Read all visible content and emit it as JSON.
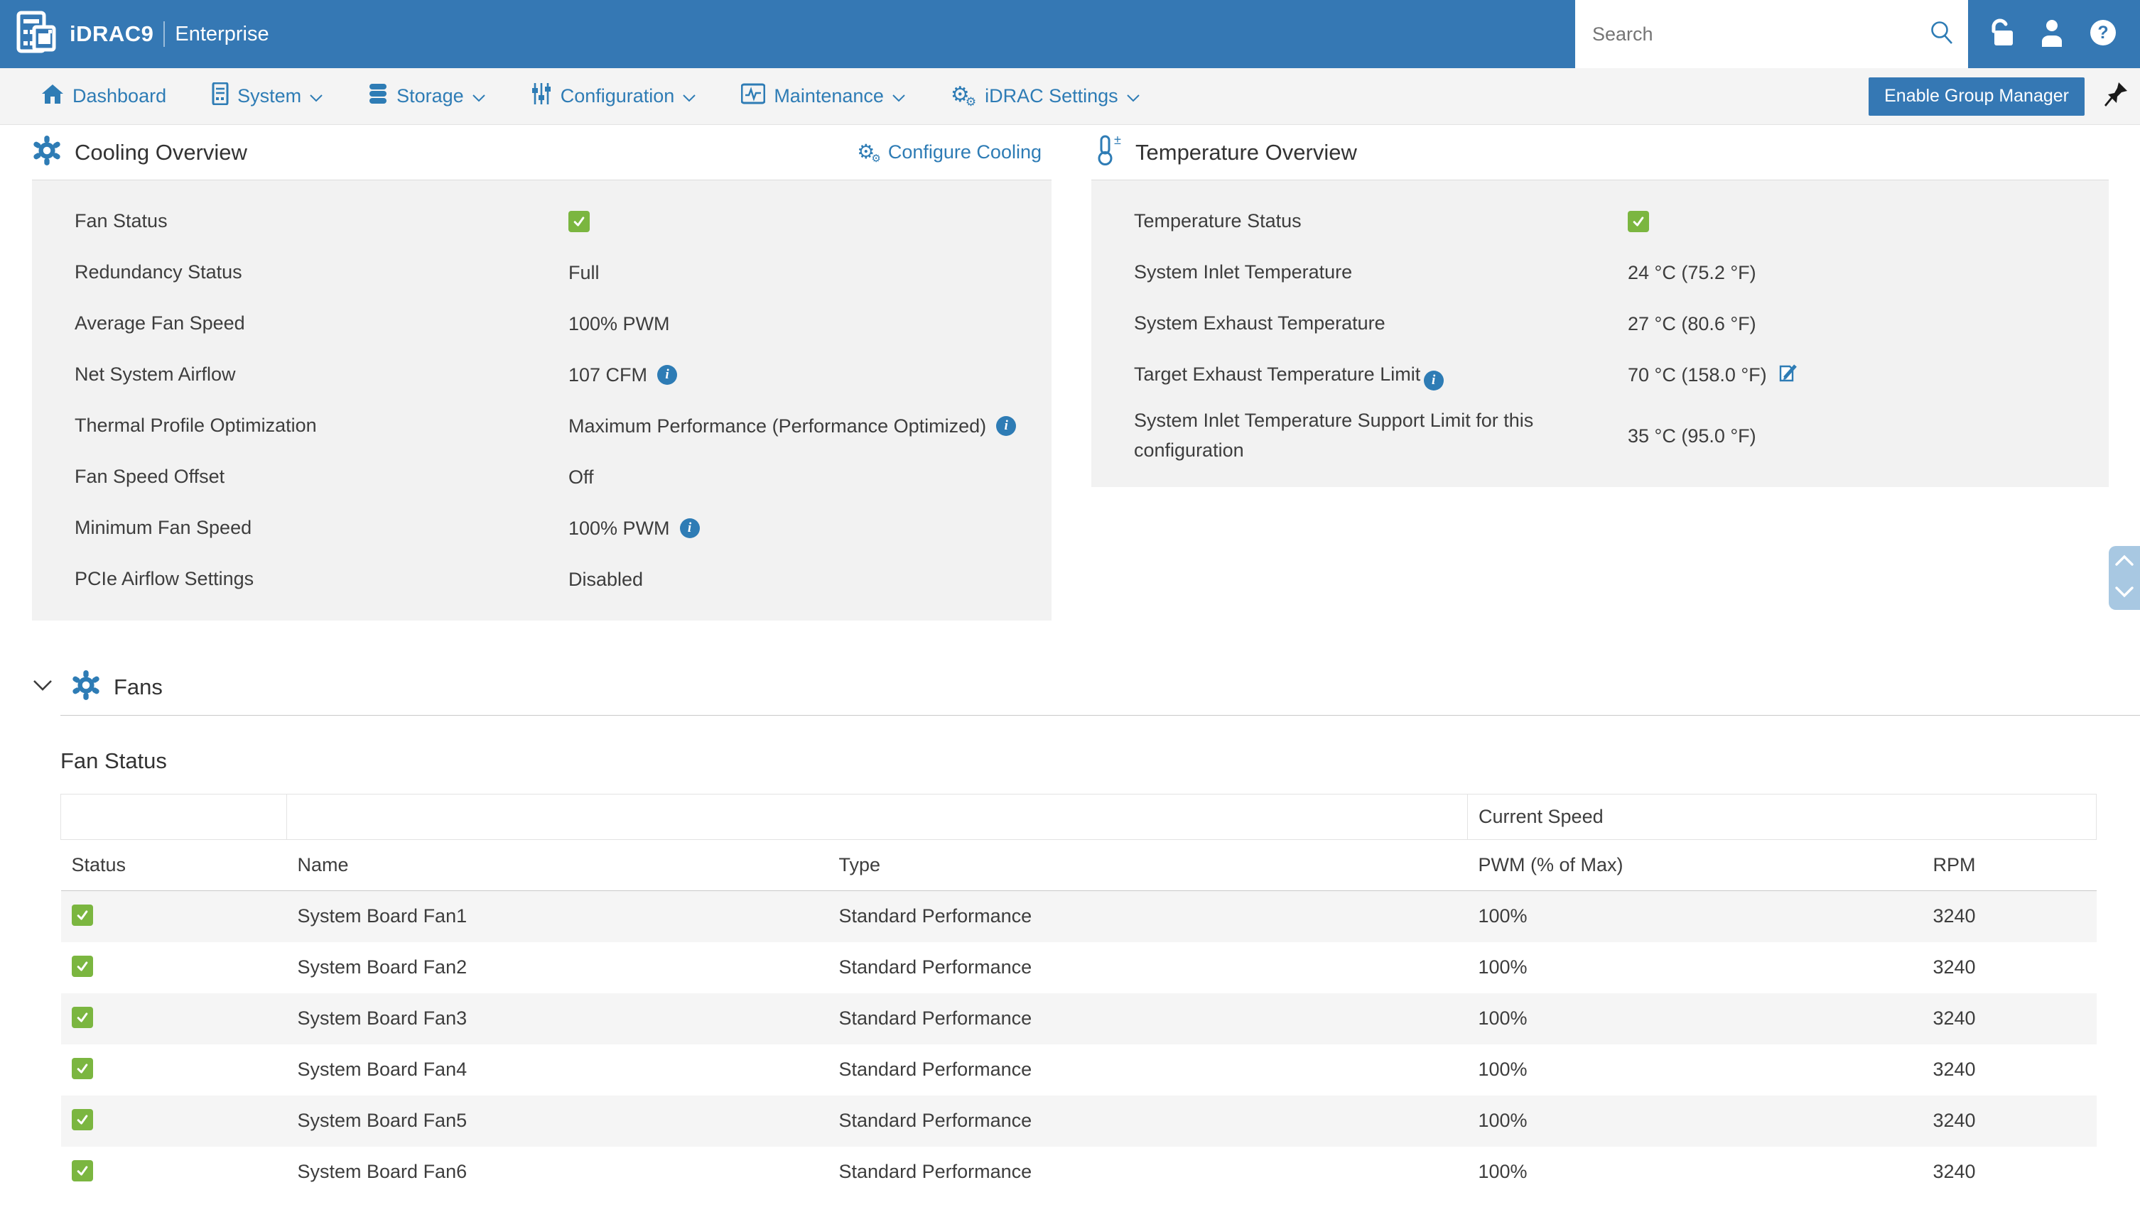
{
  "header": {
    "product": "iDRAC9",
    "edition": "Enterprise",
    "search_placeholder": "Search"
  },
  "nav": {
    "items": [
      {
        "label": "Dashboard"
      },
      {
        "label": "System"
      },
      {
        "label": "Storage"
      },
      {
        "label": "Configuration"
      },
      {
        "label": "Maintenance"
      },
      {
        "label": "iDRAC Settings"
      }
    ],
    "enable_group_manager_label": "Enable Group Manager"
  },
  "cooling_overview": {
    "title": "Cooling Overview",
    "configure_link": "Configure Cooling",
    "rows": [
      {
        "label": "Fan Status",
        "value": "OK"
      },
      {
        "label": "Redundancy Status",
        "value": "Full"
      },
      {
        "label": "Average Fan Speed",
        "value": "100% PWM"
      },
      {
        "label": "Net System Airflow",
        "value": "107 CFM"
      },
      {
        "label": "Thermal Profile Optimization",
        "value": "Maximum Performance (Performance Optimized)"
      },
      {
        "label": "Fan Speed Offset",
        "value": "Off"
      },
      {
        "label": "Minimum Fan Speed",
        "value": "100% PWM"
      },
      {
        "label": "PCIe Airflow Settings",
        "value": "Disabled"
      }
    ]
  },
  "temperature_overview": {
    "title": "Temperature Overview",
    "rows": [
      {
        "label": "Temperature Status",
        "value": "OK"
      },
      {
        "label": "System Inlet Temperature",
        "value": "24 °C (75.2 °F)"
      },
      {
        "label": "System Exhaust Temperature",
        "value": "27 °C (80.6 °F)"
      },
      {
        "label": "Target Exhaust Temperature Limit",
        "value": "70 °C (158.0 °F)"
      },
      {
        "label": "System Inlet Temperature Support Limit for this configuration",
        "value": "35 °C (95.0 °F)"
      }
    ]
  },
  "fans_section": {
    "title": "Fans",
    "table_title": "Fan Status",
    "group_header": "Current Speed",
    "columns": [
      "Status",
      "Name",
      "Type",
      "PWM (% of Max)",
      "RPM"
    ],
    "rows": [
      {
        "status": "OK",
        "name": "System Board Fan1",
        "type": "Standard Performance",
        "pwm": "100%",
        "rpm": "3240"
      },
      {
        "status": "OK",
        "name": "System Board Fan2",
        "type": "Standard Performance",
        "pwm": "100%",
        "rpm": "3240"
      },
      {
        "status": "OK",
        "name": "System Board Fan3",
        "type": "Standard Performance",
        "pwm": "100%",
        "rpm": "3240"
      },
      {
        "status": "OK",
        "name": "System Board Fan4",
        "type": "Standard Performance",
        "pwm": "100%",
        "rpm": "3240"
      },
      {
        "status": "OK",
        "name": "System Board Fan5",
        "type": "Standard Performance",
        "pwm": "100%",
        "rpm": "3240"
      },
      {
        "status": "OK",
        "name": "System Board Fan6",
        "type": "Standard Performance",
        "pwm": "100%",
        "rpm": "3240"
      }
    ]
  },
  "colors": {
    "header_blue": "#3578b4",
    "link_blue": "#2e7cb5",
    "status_green": "#7bb640",
    "panel_gray": "#f2f2f2"
  }
}
